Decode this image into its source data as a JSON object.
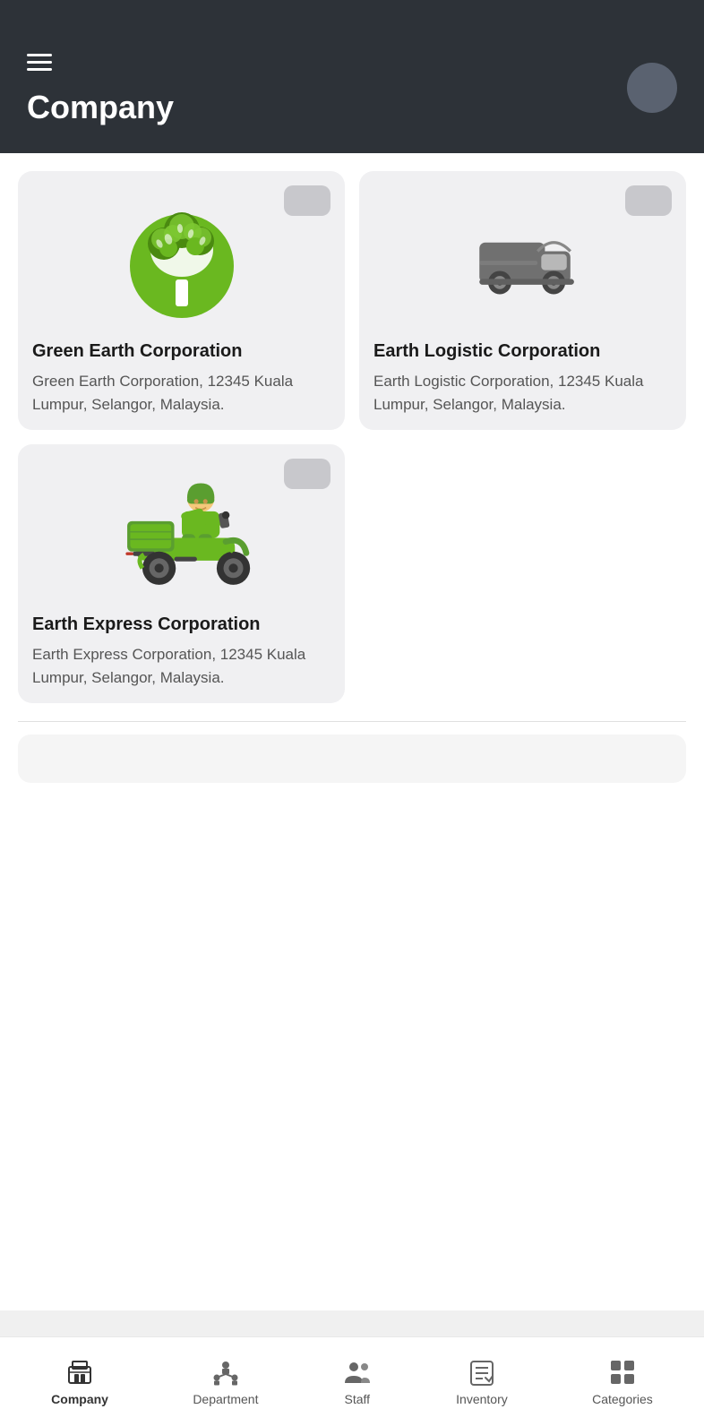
{
  "header": {
    "title": "Company",
    "menu_icon": "hamburger-icon"
  },
  "companies": [
    {
      "id": "green-earth",
      "name": "Green Earth Corporation",
      "address": "Green Earth Corporation, 12345 Kuala Lumpur, Selangor, Malaysia.",
      "image_type": "tree"
    },
    {
      "id": "earth-logistic",
      "name": "Earth Logistic Corporation",
      "address": "Earth Logistic Corporation, 12345 Kuala Lumpur, Selangor, Malaysia.",
      "image_type": "truck"
    },
    {
      "id": "earth-express",
      "name": "Earth Express Corporation",
      "address": "Earth Express Corporation, 12345 Kuala Lumpur, Selangor, Malaysia.",
      "image_type": "scooter"
    }
  ],
  "bottom_nav": [
    {
      "id": "company",
      "label": "Company",
      "active": true
    },
    {
      "id": "department",
      "label": "Department",
      "active": false
    },
    {
      "id": "staff",
      "label": "Staff",
      "active": false
    },
    {
      "id": "inventory",
      "label": "Inventory",
      "active": false
    },
    {
      "id": "categories",
      "label": "Categories",
      "active": false
    }
  ]
}
